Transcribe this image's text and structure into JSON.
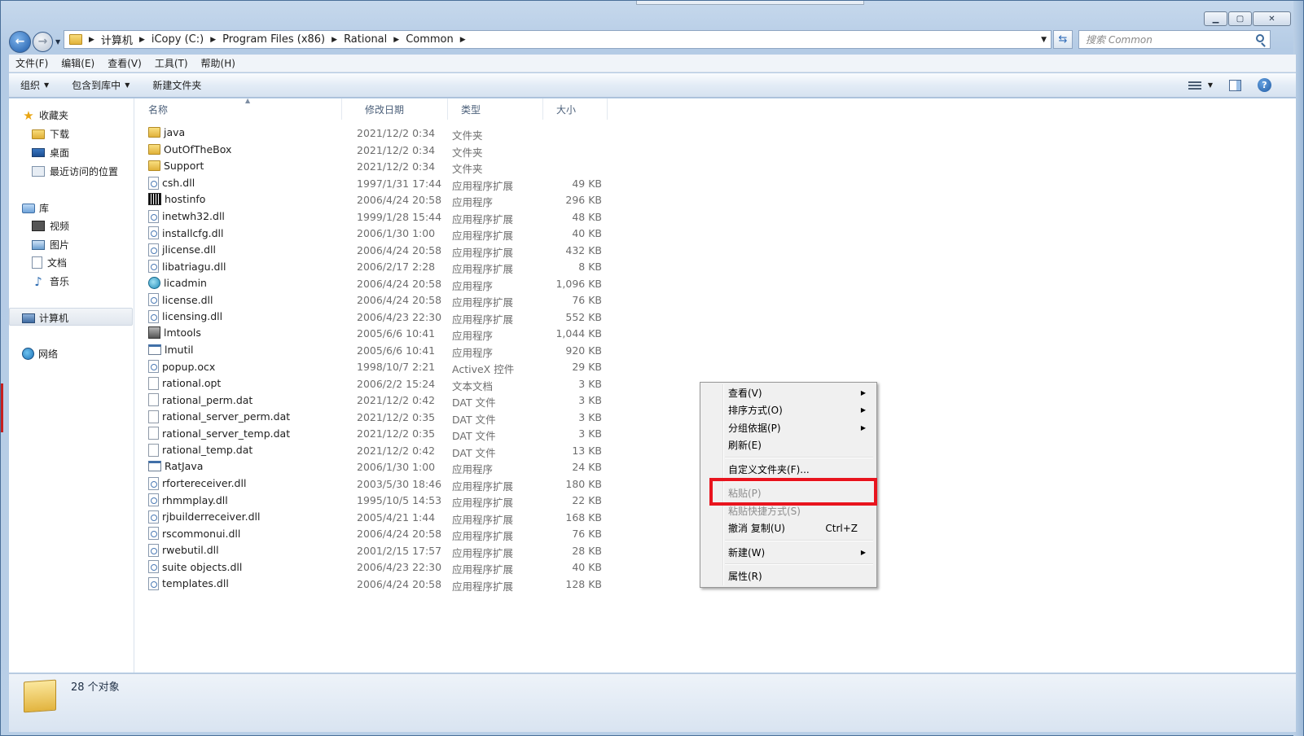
{
  "window": {
    "controls": {
      "minimize": "▁",
      "maximize": "▢",
      "close": "✕"
    }
  },
  "address": {
    "breadcrumbs": [
      "计算机",
      "iCopy (C:)",
      "Program Files (x86)",
      "Rational",
      "Common"
    ],
    "search_placeholder": "搜索 Common"
  },
  "menubar": [
    "文件(F)",
    "编辑(E)",
    "查看(V)",
    "工具(T)",
    "帮助(H)"
  ],
  "toolbar": {
    "organize": "组织",
    "include_in_library": "包含到库中",
    "new_folder": "新建文件夹"
  },
  "navpane": {
    "favorites": "收藏夹",
    "favorites_items": [
      "下载",
      "桌面",
      "最近访问的位置"
    ],
    "libraries": "库",
    "libraries_items": [
      "视频",
      "图片",
      "文档",
      "音乐"
    ],
    "computer": "计算机",
    "network": "网络"
  },
  "columns": {
    "name": "名称",
    "date": "修改日期",
    "type": "类型",
    "size": "大小"
  },
  "files": [
    {
      "name": "java",
      "date": "2021/12/2 0:34",
      "type": "文件夹",
      "size": "",
      "icon": "folder"
    },
    {
      "name": "OutOfTheBox",
      "date": "2021/12/2 0:34",
      "type": "文件夹",
      "size": "",
      "icon": "folder"
    },
    {
      "name": "Support",
      "date": "2021/12/2 0:34",
      "type": "文件夹",
      "size": "",
      "icon": "folder"
    },
    {
      "name": "csh.dll",
      "date": "1997/1/31 17:44",
      "type": "应用程序扩展",
      "size": "49 KB",
      "icon": "dll"
    },
    {
      "name": "hostinfo",
      "date": "2006/4/24 20:58",
      "type": "应用程序",
      "size": "296 KB",
      "icon": "barcode"
    },
    {
      "name": "inetwh32.dll",
      "date": "1999/1/28 15:44",
      "type": "应用程序扩展",
      "size": "48 KB",
      "icon": "dll"
    },
    {
      "name": "installcfg.dll",
      "date": "2006/1/30 1:00",
      "type": "应用程序扩展",
      "size": "40 KB",
      "icon": "dll"
    },
    {
      "name": "jlicense.dll",
      "date": "2006/4/24 20:58",
      "type": "应用程序扩展",
      "size": "432 KB",
      "icon": "dll"
    },
    {
      "name": "libatriagu.dll",
      "date": "2006/2/17 2:28",
      "type": "应用程序扩展",
      "size": "8 KB",
      "icon": "dll"
    },
    {
      "name": "licadmin",
      "date": "2006/4/24 20:58",
      "type": "应用程序",
      "size": "1,096 KB",
      "icon": "licadmin"
    },
    {
      "name": "license.dll",
      "date": "2006/4/24 20:58",
      "type": "应用程序扩展",
      "size": "76 KB",
      "icon": "dll"
    },
    {
      "name": "licensing.dll",
      "date": "2006/4/23 22:30",
      "type": "应用程序扩展",
      "size": "552 KB",
      "icon": "dll"
    },
    {
      "name": "lmtools",
      "date": "2005/6/6 10:41",
      "type": "应用程序",
      "size": "1,044 KB",
      "icon": "lmtools"
    },
    {
      "name": "lmutil",
      "date": "2005/6/6 10:41",
      "type": "应用程序",
      "size": "920 KB",
      "icon": "exe"
    },
    {
      "name": "popup.ocx",
      "date": "1998/10/7 2:21",
      "type": "ActiveX 控件",
      "size": "29 KB",
      "icon": "dll"
    },
    {
      "name": "rational.opt",
      "date": "2006/2/2 15:24",
      "type": "文本文档",
      "size": "3 KB",
      "icon": "txt"
    },
    {
      "name": "rational_perm.dat",
      "date": "2021/12/2 0:42",
      "type": "DAT 文件",
      "size": "3 KB",
      "icon": "txt"
    },
    {
      "name": "rational_server_perm.dat",
      "date": "2021/12/2 0:35",
      "type": "DAT 文件",
      "size": "3 KB",
      "icon": "txt"
    },
    {
      "name": "rational_server_temp.dat",
      "date": "2021/12/2 0:35",
      "type": "DAT 文件",
      "size": "3 KB",
      "icon": "txt"
    },
    {
      "name": "rational_temp.dat",
      "date": "2021/12/2 0:42",
      "type": "DAT 文件",
      "size": "13 KB",
      "icon": "txt"
    },
    {
      "name": "RatJava",
      "date": "2006/1/30 1:00",
      "type": "应用程序",
      "size": "24 KB",
      "icon": "exe"
    },
    {
      "name": "rfortereceiver.dll",
      "date": "2003/5/30 18:46",
      "type": "应用程序扩展",
      "size": "180 KB",
      "icon": "dll"
    },
    {
      "name": "rhmmplay.dll",
      "date": "1995/10/5 14:53",
      "type": "应用程序扩展",
      "size": "22 KB",
      "icon": "dll"
    },
    {
      "name": "rjbuilderreceiver.dll",
      "date": "2005/4/21 1:44",
      "type": "应用程序扩展",
      "size": "168 KB",
      "icon": "dll"
    },
    {
      "name": "rscommonui.dll",
      "date": "2006/4/24 20:58",
      "type": "应用程序扩展",
      "size": "76 KB",
      "icon": "dll"
    },
    {
      "name": "rwebutil.dll",
      "date": "2001/2/15 17:57",
      "type": "应用程序扩展",
      "size": "28 KB",
      "icon": "dll"
    },
    {
      "name": "suite objects.dll",
      "date": "2006/4/23 22:30",
      "type": "应用程序扩展",
      "size": "40 KB",
      "icon": "dll"
    },
    {
      "name": "templates.dll",
      "date": "2006/4/24 20:58",
      "type": "应用程序扩展",
      "size": "128 KB",
      "icon": "dll"
    }
  ],
  "status": {
    "count_text": "28 个对象"
  },
  "context_menu": {
    "view": "查看(V)",
    "sort_by": "排序方式(O)",
    "group_by": "分组依据(P)",
    "refresh": "刷新(E)",
    "customize_folder": "自定义文件夹(F)...",
    "paste": "粘贴(P)",
    "paste_shortcut": "粘贴快捷方式(S)",
    "undo_copy": "撤消 复制(U)",
    "undo_shortcut": "Ctrl+Z",
    "new": "新建(W)",
    "properties": "属性(R)"
  },
  "colors": {
    "highlight_box": "#e8141e",
    "titlebar": "#b9cfe7"
  }
}
